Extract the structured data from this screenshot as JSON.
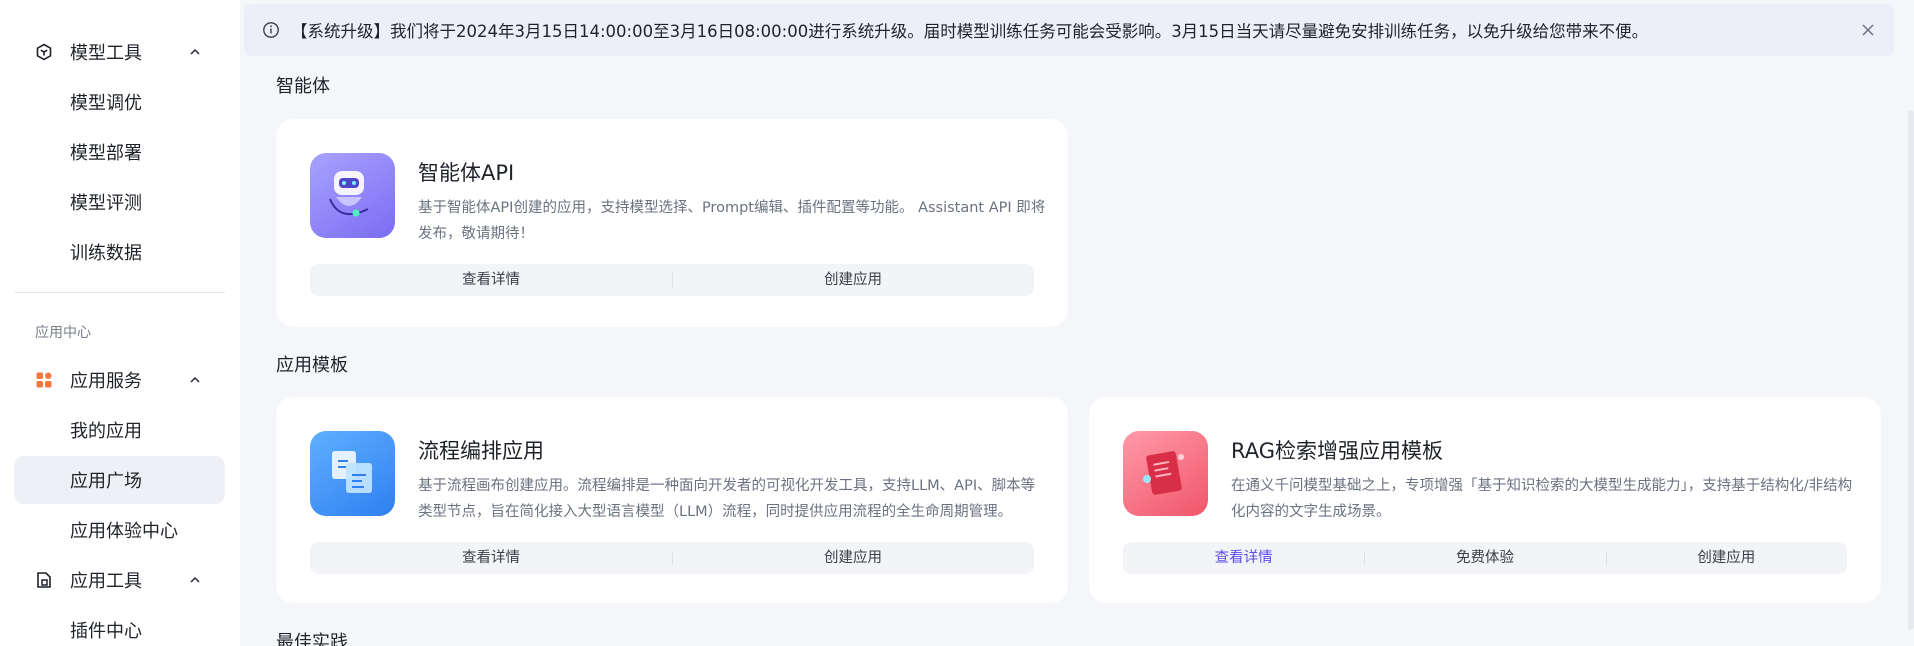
{
  "sidebar": {
    "model_tools": {
      "label": "模型工具",
      "items": [
        "模型调优",
        "模型部署",
        "模型评测",
        "训练数据"
      ]
    },
    "section_label": "应用中心",
    "app_services": {
      "label": "应用服务",
      "items": [
        "我的应用",
        "应用广场",
        "应用体验中心"
      ],
      "active": "应用广场"
    },
    "app_tools": {
      "label": "应用工具",
      "items": [
        "插件中心"
      ]
    }
  },
  "banner": {
    "text": "【系统升级】我们将于2024年3月15日14:00:00至3月16日08:00:00进行系统升级。届时模型训练任务可能会受影响。3月15日当天请尽量避免安排训练任务，以免升级给您带来不便。"
  },
  "sections": {
    "agent": "智能体",
    "templates": "应用模板",
    "best_practice": "最佳实践"
  },
  "cards": {
    "agent_api": {
      "title": "智能体API",
      "desc": "基于智能体API创建的应用，支持模型选择、Prompt编辑、插件配置等功能。 Assistant API 即将发布，敬请期待！",
      "actions": [
        "查看详情",
        "创建应用"
      ]
    },
    "flow": {
      "title": "流程编排应用",
      "desc": "基于流程画布创建应用。流程编排是一种面向开发者的可视化开发工具，支持LLM、API、脚本等类型节点，旨在简化接入大型语言模型（LLM）流程，同时提供应用流程的全生命周期管理。",
      "actions": [
        "查看详情",
        "创建应用"
      ]
    },
    "rag": {
      "title": "RAG检索增强应用模板",
      "desc": "在通义千问模型基础之上，专项增强「基于知识检索的大模型生成能力」，支持基于结构化/非结构化内容的文字生成场景。",
      "actions": [
        "查看详情",
        "免费体验",
        "创建应用"
      ]
    }
  },
  "colors": {
    "accent": "#5b4cf0",
    "banner_bg": "#eeeefb",
    "page_bg": "#f5f6f9"
  },
  "icons": {
    "model_tools": "cube-hex-icon",
    "app_services": "grid-apps-icon",
    "app_tools": "document-tool-icon",
    "info": "info-circle-icon",
    "close": "close-icon"
  }
}
